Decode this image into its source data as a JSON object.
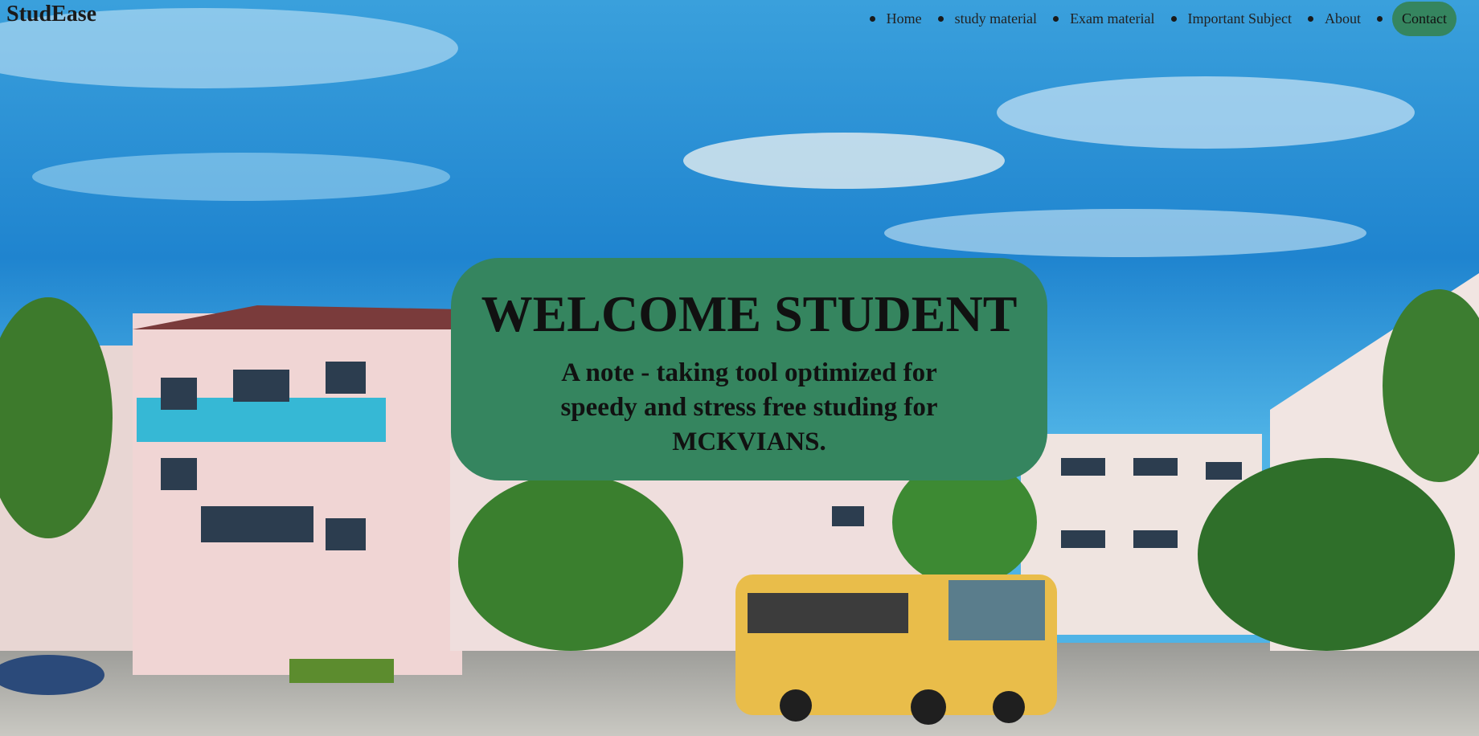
{
  "brand": "StudEase",
  "nav": {
    "items": [
      {
        "label": "Home"
      },
      {
        "label": "study material"
      },
      {
        "label": "Exam material"
      },
      {
        "label": "Important Subject"
      },
      {
        "label": "About"
      },
      {
        "label": "Contact"
      }
    ]
  },
  "hero": {
    "title": "WELCOME STUDENT",
    "subtitle": "A note - taking tool optimized for speedy and stress free studing for MCKVIANS."
  },
  "colors": {
    "accent": "#35855f",
    "sky": "#2a8fd4",
    "text": "#111111"
  }
}
